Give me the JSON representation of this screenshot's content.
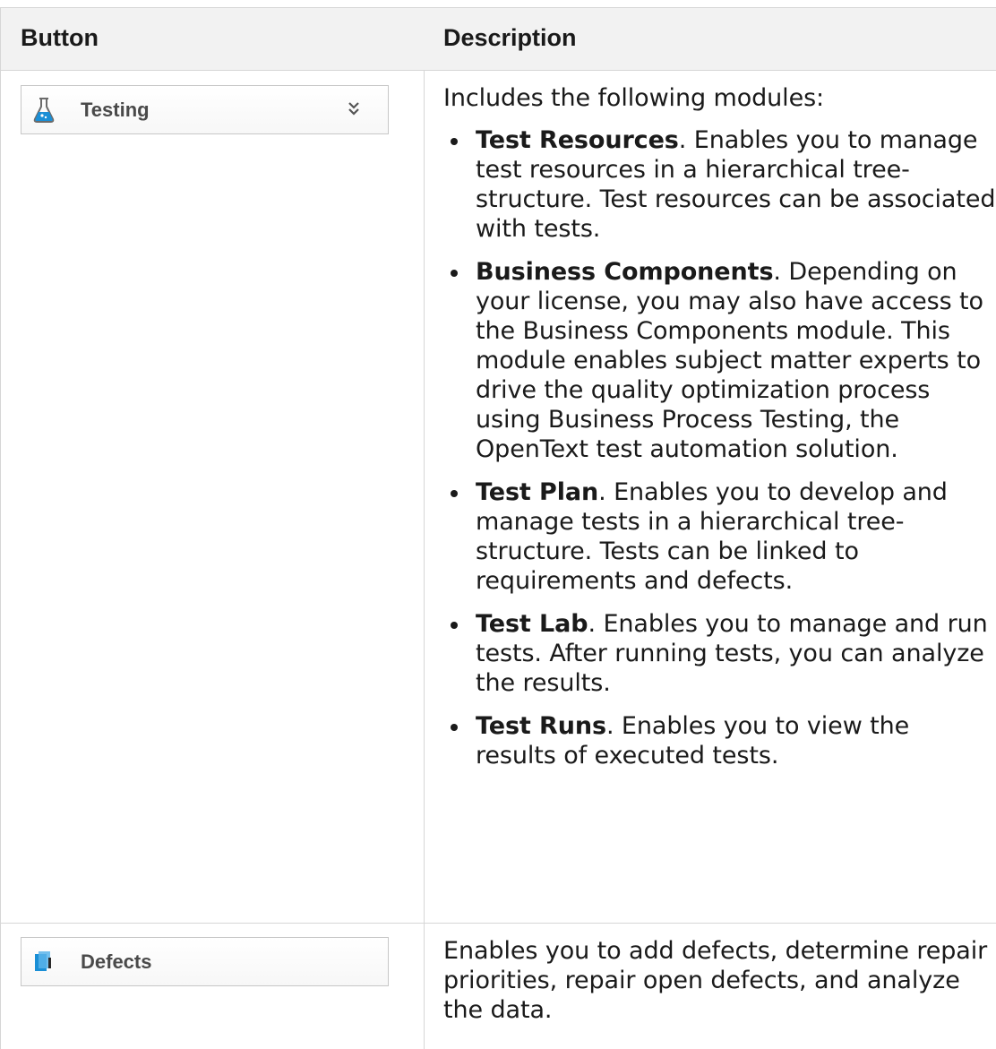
{
  "table": {
    "headers": {
      "button": "Button",
      "description": "Description"
    },
    "rows": [
      {
        "button_label": "Testing",
        "button_icon": "flask-icon",
        "has_expand": true,
        "intro": "Includes the following modules:",
        "items": [
          {
            "title": "Test Resources",
            "text": ". Enables you to manage test resources in a hierarchical tree-structure. Test resources can be associated with tests."
          },
          {
            "title": "Business Components",
            "text": ". Depending on your license, you may also have access to the Business Components module. This module enables subject matter experts to drive the quality optimization process using Business Process Testing, the OpenText test automation solution."
          },
          {
            "title": "Test Plan",
            "text": ". Enables you to develop and manage tests in a hierarchical tree-structure. Tests can be linked to requirements and defects."
          },
          {
            "title": "Test Lab",
            "text": ". Enables you to manage and run tests. After running tests, you can analyze the results."
          },
          {
            "title": "Test Runs",
            "text": ". Enables you to view the results of executed tests."
          }
        ]
      },
      {
        "button_label": "Defects",
        "button_icon": "defects-icon",
        "has_expand": false,
        "intro": "Enables you to add defects, determine repair priorities, repair open defects, and analyze the data."
      }
    ]
  },
  "colors": {
    "border": "#d6d6d6",
    "header_bg": "#f2f2f2",
    "icon_blue": "#1a8fd6",
    "text": "#1a1a1a"
  }
}
